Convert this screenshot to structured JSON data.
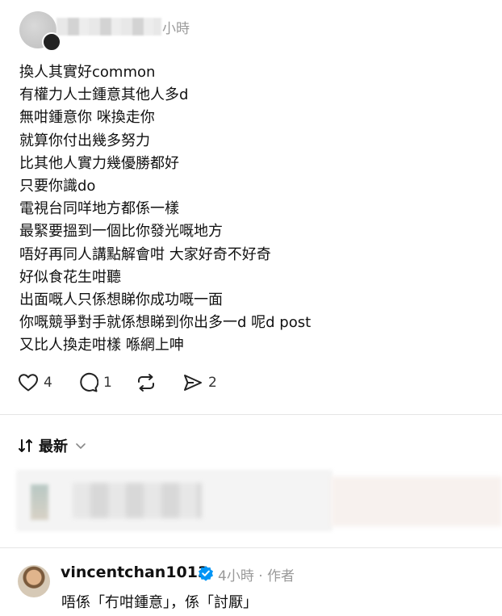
{
  "post": {
    "time_ago": "小時",
    "lines": [
      "換人其實好common",
      "有權力人士鍾意其他人多d",
      "無咁鍾意你 咪換走你",
      "就算你付出幾多努力",
      "比其他人實力幾優勝都好",
      "只要你識do",
      "電視台同咩地方都係一樣",
      "最緊要搵到一個比你發光嘅地方",
      "唔好再同人講點解會咁 大家好奇不好奇",
      "好似食花生咁聽",
      "出面嘅人只係想睇你成功嘅一面",
      "你嘅競爭對手就係想睇到你出多一d 呢d post",
      "又比人換走咁樣 喺網上呻"
    ],
    "actions": {
      "likes": "4",
      "comments": "1",
      "repost": "",
      "shares": "2"
    }
  },
  "sort": {
    "label": "最新"
  },
  "reply": {
    "username": "vincentchan1013",
    "meta": "4小時 · 作者",
    "text": "唔係「冇咁鍾意」，係「討厭」"
  },
  "colors": {
    "verified": "#0095f6",
    "text": "#111111",
    "muted": "#999999"
  }
}
